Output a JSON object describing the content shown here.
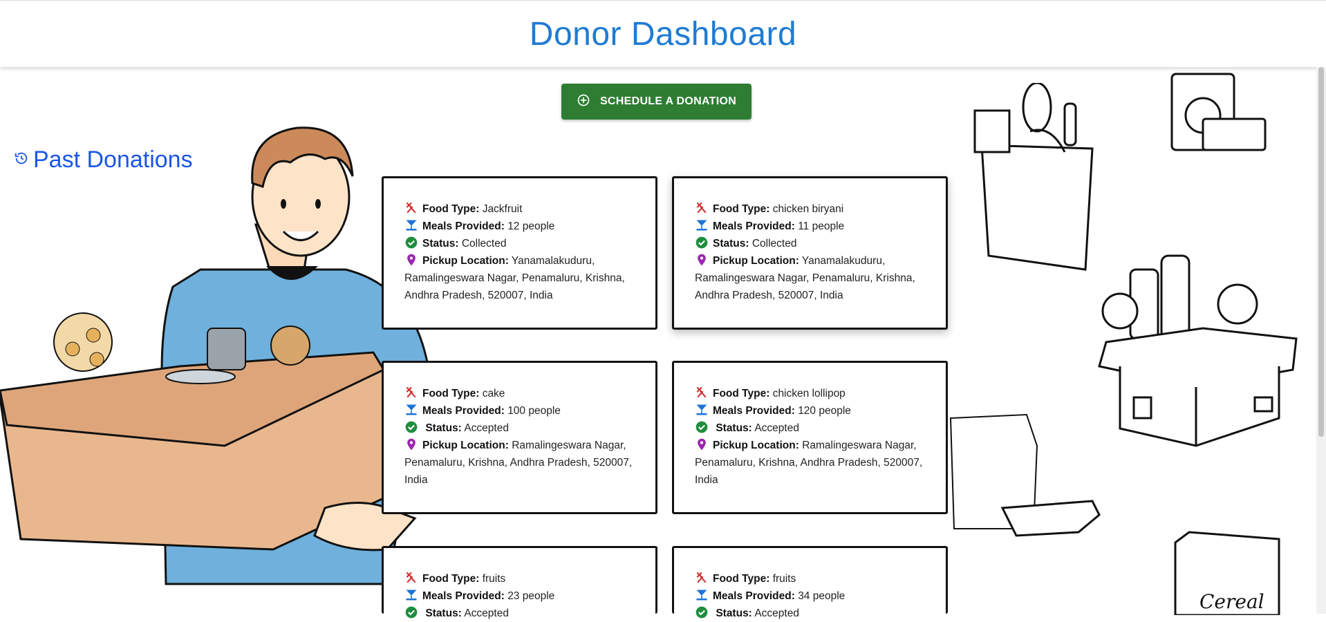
{
  "header": {
    "title": "Donor Dashboard"
  },
  "actions": {
    "schedule_label": "SCHEDULE A DONATION"
  },
  "section": {
    "title": "Past Donations"
  },
  "labels": {
    "food_type": "Food Type:",
    "meals": "Meals Provided:",
    "status": "Status:",
    "pickup": "Pickup Location:"
  },
  "donations": [
    {
      "food_type": "Jackfruit",
      "meals": "12 people",
      "status": "Collected",
      "pickup": "Yanamalakuduru, Ramalingeswara Nagar, Penamaluru, Krishna, Andhra Pradesh, 520007, India"
    },
    {
      "food_type": "chicken biryani",
      "meals": "11 people",
      "status": "Collected",
      "pickup": "Yanamalakuduru, Ramalingeswara Nagar, Penamaluru, Krishna, Andhra Pradesh, 520007, India"
    },
    {
      "food_type": "cake",
      "meals": "100 people",
      "status": "Accepted",
      "pickup": "Ramalingeswara Nagar, Penamaluru, Krishna, Andhra Pradesh, 520007, India"
    },
    {
      "food_type": "chicken lollipop",
      "meals": "120 people",
      "status": "Accepted",
      "pickup": "Ramalingeswara Nagar, Penamaluru, Krishna, Andhra Pradesh, 520007, India"
    },
    {
      "food_type": "fruits",
      "meals": "23 people",
      "status": "Accepted",
      "pickup": ""
    },
    {
      "food_type": "fruits",
      "meals": "34 people",
      "status": "Accepted",
      "pickup": ""
    }
  ],
  "colors": {
    "title_blue": "#1f7bd3",
    "section_blue": "#1a56e8",
    "button_green": "#2e7d32",
    "status_green": "#1e8e3e",
    "food_red": "#d32f2f",
    "meals_blue": "#1e73d6",
    "pin_purple": "#9c27b0"
  },
  "icons": {
    "schedule": "add-circle-icon",
    "section": "history-icon",
    "food_type": "utensils-icon",
    "meals": "scale-icon",
    "status": "check-circle-icon",
    "pickup": "location-pin-icon"
  }
}
